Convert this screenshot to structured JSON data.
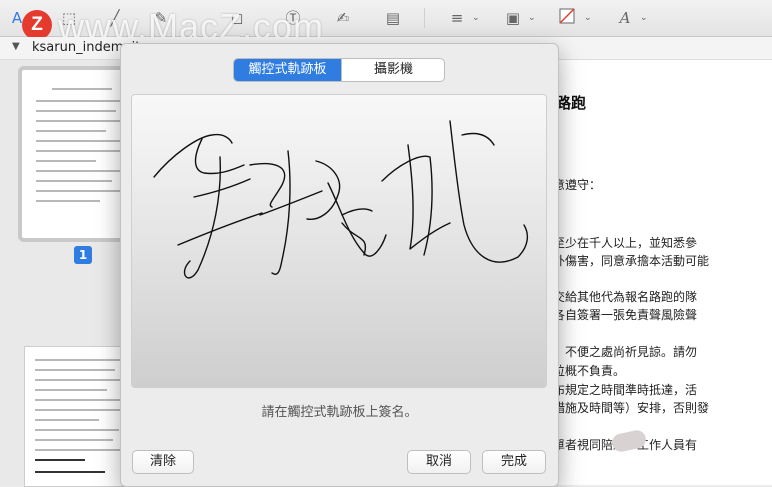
{
  "watermark": {
    "logo_letter": "Z",
    "text": "www.MacZ.com"
  },
  "toolbar": {
    "icons": [
      "text-tool-icon",
      "rect-select-icon",
      "sketch-icon",
      "draw-icon",
      "shapes-icon",
      "text-box-icon",
      "sign-icon",
      "note-icon",
      "line-style-icon",
      "border-color-icon",
      "fill-color-icon",
      "font-icon"
    ]
  },
  "document": {
    "filename": "ksarun_indemnity",
    "page_badge": "1",
    "heading": "跟路跑",
    "lines": [
      "同意遵守：",
      "數至少在千人以上，並知悉參",
      "意外傷害，同意承擔本活動可能",
      "明交給其他代為報名路跑的隊",
      "幾各自簽署一張免責聲風險聲",
      "動，不便之處尚祈見諒。請勿",
      "單位概不負責。",
      "公布規定之時間準時抵達，活",
      "制措施及時間等）安排，否則發",
      "為單者視同陪跑，工作人員有"
    ]
  },
  "signature_sheet": {
    "tabs": [
      {
        "label": "觸控式軌跡板",
        "selected": true
      },
      {
        "label": "攝影機",
        "selected": false
      }
    ],
    "hint": "請在觸控式軌跡板上簽名。",
    "buttons": {
      "clear": "清除",
      "cancel": "取消",
      "done": "完成"
    }
  },
  "colors": {
    "accent": "#2f7de1",
    "logo": "#e53b2f"
  }
}
